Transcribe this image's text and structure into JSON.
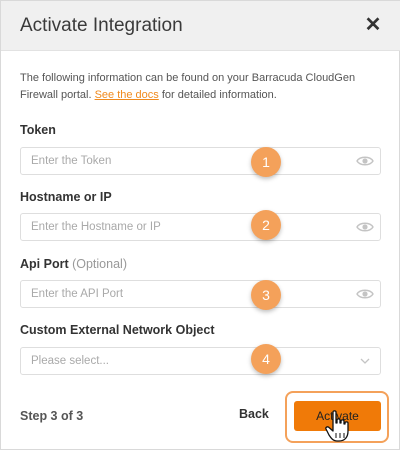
{
  "dialog": {
    "title": "Activate Integration",
    "close_icon": "close-icon"
  },
  "intro": {
    "text_before": "The following information can be found on your Barracuda CloudGen Firewall portal. ",
    "link_text": "See the docs",
    "text_after": " for detailed information."
  },
  "fields": {
    "token": {
      "label": "Token",
      "placeholder": "Enter the Token",
      "value": ""
    },
    "hostname": {
      "label": "Hostname or IP",
      "placeholder": "Enter the Hostname or IP",
      "value": ""
    },
    "api_port": {
      "label": "Api Port",
      "optional": "(Optional)",
      "placeholder": "Enter the API Port",
      "value": ""
    },
    "network_object": {
      "label": "Custom External Network Object",
      "selected": "Please select..."
    }
  },
  "markers": [
    "1",
    "2",
    "3",
    "4"
  ],
  "footer": {
    "step": "Step 3 of 3",
    "back_label": "Back",
    "activate_label": "Activate"
  },
  "colors": {
    "accent": "#f07a08",
    "marker": "#f4a15a",
    "link": "#f08a1d"
  }
}
